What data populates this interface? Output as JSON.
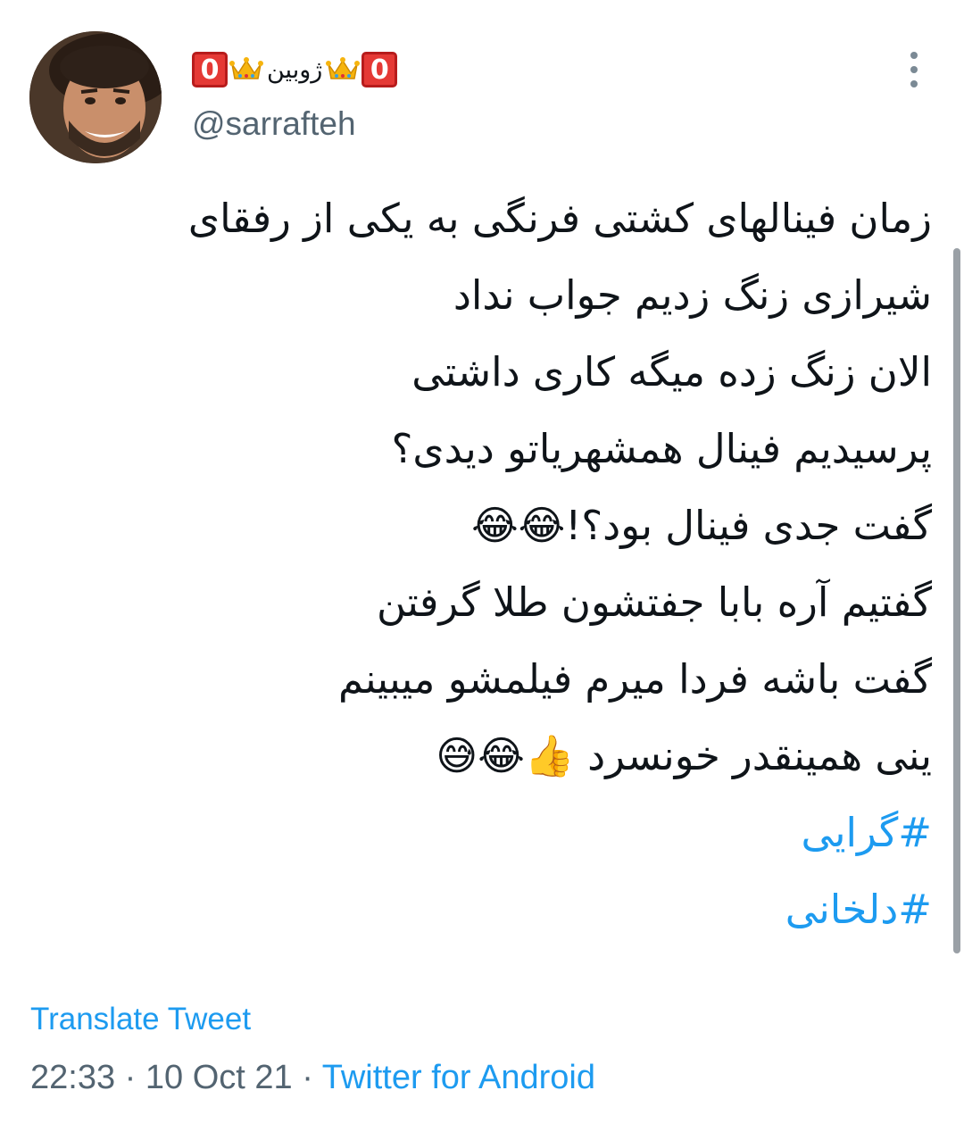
{
  "author": {
    "display_name": "ژوبین",
    "badge_text": "0",
    "badge_color": "#e53935",
    "crown_icon": "crown-icon",
    "handle": "@sarrafteh",
    "avatar_icon": "avatar-photo"
  },
  "menu": {
    "icon": "more-vertical-icon"
  },
  "tweet": {
    "lines": [
      "زمان فینالهای کشتی فرنگی به یکی از رفقای",
      "شیرازی زنگ زدیم جواب نداد",
      "الان زنگ زده میگه کاری داشتی",
      "پرسیدیم فینال همشهریاتو دیدی؟",
      "گفت جدی فینال بود؟!😂😂",
      "گفتیم آره بابا جفتشون طلا گرفتن",
      "گفت باشه فردا میرم فیلمشو میبینم",
      "ینی همینقدر خونسرد 👍😂😅"
    ],
    "hashtags": [
      "#گرایی",
      "#دلخانی"
    ]
  },
  "translate_label": "Translate Tweet",
  "meta": {
    "time": "22:33",
    "separator": " · ",
    "date": "10 Oct 21",
    "source": "Twitter for Android"
  },
  "colors": {
    "link": "#1d9bf0",
    "secondary_text": "#536471",
    "primary_text": "#0f1419"
  }
}
